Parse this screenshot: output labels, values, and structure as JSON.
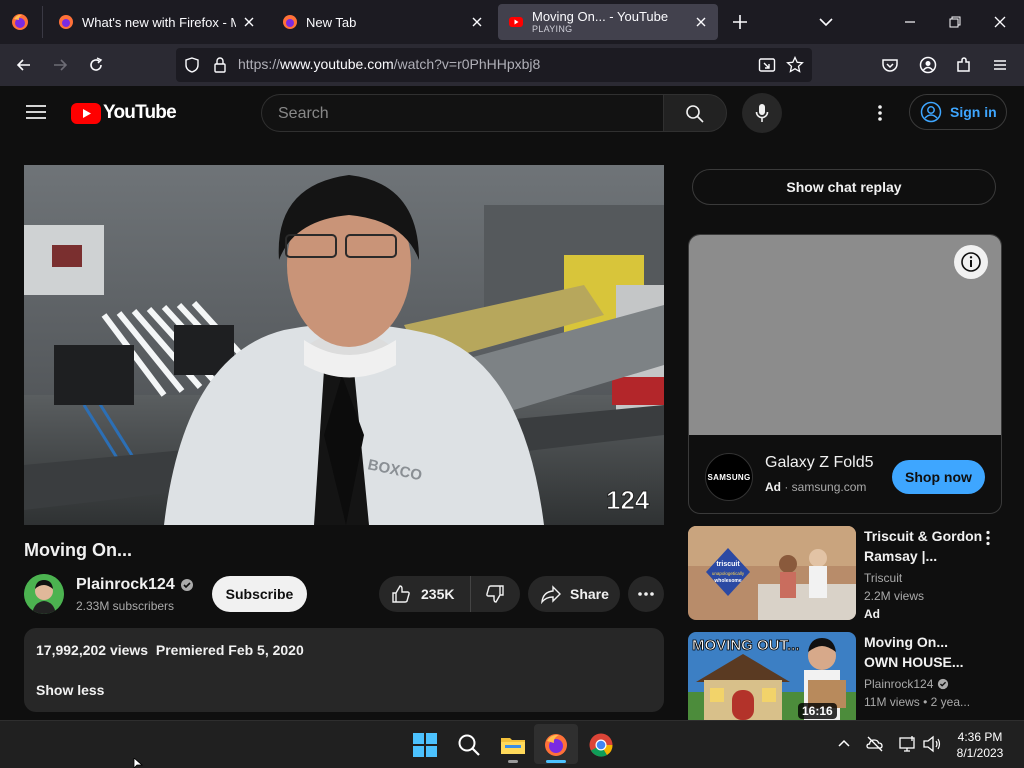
{
  "browser": {
    "tabs": [
      {
        "title": "What's new with Firefox - More"
      },
      {
        "title": "New Tab"
      },
      {
        "title": "Moving On... - YouTube",
        "status": "PLAYING"
      }
    ],
    "url": {
      "scheme": "https://",
      "host": "www.youtube.com",
      "path": "/watch?v=r0PhHHpxbj8"
    }
  },
  "youtube": {
    "logo_text": "YouTube",
    "search_placeholder": "Search",
    "sign_in": "Sign in"
  },
  "video": {
    "watermark": "124",
    "shirt_text": "BOXCO",
    "title": "Moving On...",
    "channel": "Plainrock124",
    "subscribers": "2.33M subscribers",
    "subscribe_label": "Subscribe",
    "likes": "235K",
    "share_label": "Share",
    "views": "17,992,202 views",
    "premiered": "Premiered Feb 5, 2020",
    "show_less": "Show less"
  },
  "sidebar": {
    "chat_replay": "Show chat replay",
    "ad": {
      "title": "Galaxy Z Fold5",
      "badge": "Ad",
      "domain": "samsung.com",
      "logo_text": "SAMSUNG",
      "cta": "Shop now"
    },
    "recommendations": [
      {
        "title_line1": "Triscuit & Gordon",
        "title_line2": "Ramsay |...",
        "channel": "Triscuit",
        "views": "2.2M views",
        "badge": "Ad",
        "thumb_text1": "triscuit",
        "thumb_text2": "unapologetically",
        "thumb_text3": "wholesome"
      },
      {
        "title_line1": "Moving On...",
        "title_line2": "OWN HOUSE...",
        "channel": "Plainrock124",
        "views": "11M views",
        "age": "2 yea...",
        "duration": "16:16",
        "thumb_text": "MOVING OUT..."
      }
    ]
  },
  "taskbar": {
    "time": "4:36 PM",
    "date": "8/1/2023"
  },
  "colors": {
    "accent_blue": "#3ea6ff",
    "youtube_red": "#ff0000",
    "background": "#0f0f0f"
  }
}
